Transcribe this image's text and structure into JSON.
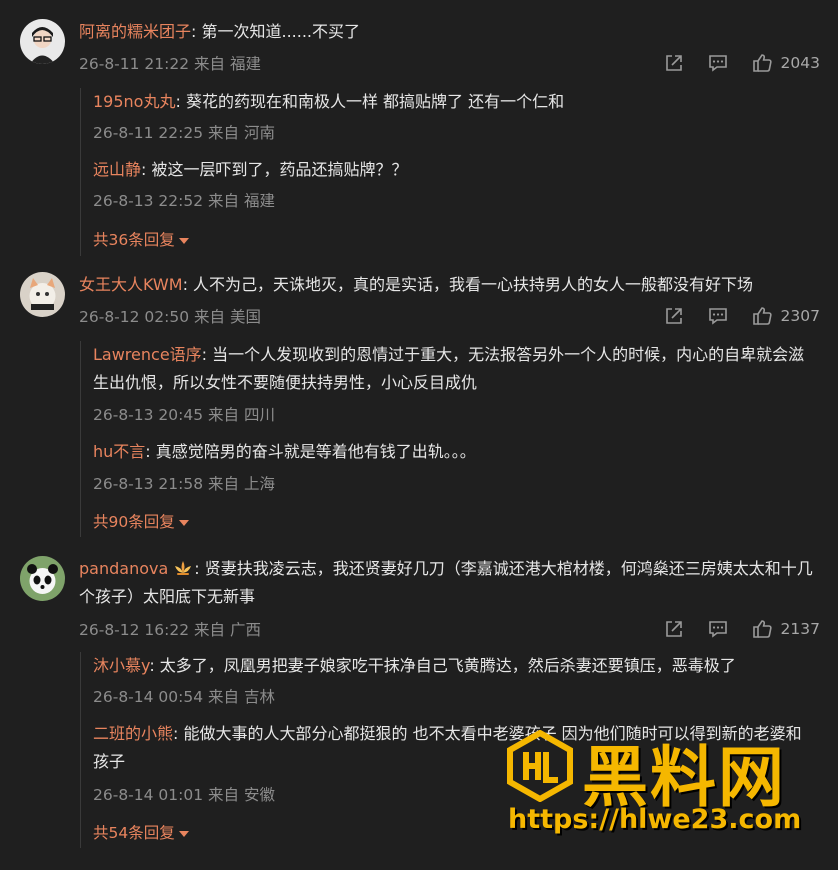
{
  "comments": [
    {
      "username": "阿离的糯米团子",
      "text": ": 第一次知道......不买了",
      "time": "26-8-11 21:22",
      "location": "来自 福建",
      "likes": "2043",
      "replies": [
        {
          "username": "195no丸丸",
          "text": ": 葵花的药现在和南极人一样 都搞贴牌了 还有一个仁和",
          "time": "26-8-11 22:25",
          "location": "来自 河南"
        },
        {
          "username": "远山静",
          "text": ": 被这一层吓到了，药品还搞贴牌？？",
          "time": "26-8-13 22:52",
          "location": "来自 福建"
        }
      ],
      "more": "共36条回复"
    },
    {
      "username": "女王大人KWM",
      "text": ": 人不为己，天诛地灭，真的是实话，我看一心扶持男人的女人一般都没有好下场",
      "time": "26-8-12 02:50",
      "location": "来自 美国",
      "likes": "2307",
      "replies": [
        {
          "username": "Lawrence语序",
          "text": ": 当一个人发现收到的恩情过于重大，无法报答另外一个人的时候，内心的自卑就会滋生出仇恨，所以女性不要随便扶持男性，小心反目成仇",
          "time": "26-8-13 20:45",
          "location": "来自 四川"
        },
        {
          "username": "hu不言",
          "text": ": 真感觉陪男的奋斗就是等着他有钱了出轨。。。",
          "time": "26-8-13 21:58",
          "location": "来自 上海"
        }
      ],
      "more": "共90条回复"
    },
    {
      "username": "pandanova",
      "text": ": 贤妻扶我凌云志，我还贤妻好几刀（李嘉诚还港大棺材楼，何鸿燊还三房姨太太和十几个孩子）太阳底下无新事",
      "time": "26-8-12 16:22",
      "location": "来自 广西",
      "likes": "2137",
      "replies": [
        {
          "username": "沐小慕y",
          "text": ": 太多了，凤凰男把妻子娘家吃干抹净自己飞黄腾达，然后杀妻还要镇压，恶毒极了",
          "time": "26-8-14 00:54",
          "location": "来自 吉林"
        },
        {
          "username": "二班的小熊",
          "text": ": 能做大事的人大部分心都挺狠的 也不太看中老婆孩子 因为他们随时可以得到新的老婆和孩子",
          "time": "26-8-14 01:01",
          "location": "来自 安徽"
        }
      ],
      "more": "共54条回复"
    }
  ],
  "icons": {
    "share": "share-icon",
    "comment": "comment-icon",
    "like": "like-icon",
    "caret": "caret-down-icon",
    "badge": "lotus-badge-icon"
  },
  "colors": {
    "background": "#1f1f1f",
    "username": "#e8845e",
    "meta": "#8c8c8c",
    "watermark": "#f5b700"
  },
  "watermark": {
    "title": "黑料网",
    "url": "https://hlwe23.com"
  }
}
